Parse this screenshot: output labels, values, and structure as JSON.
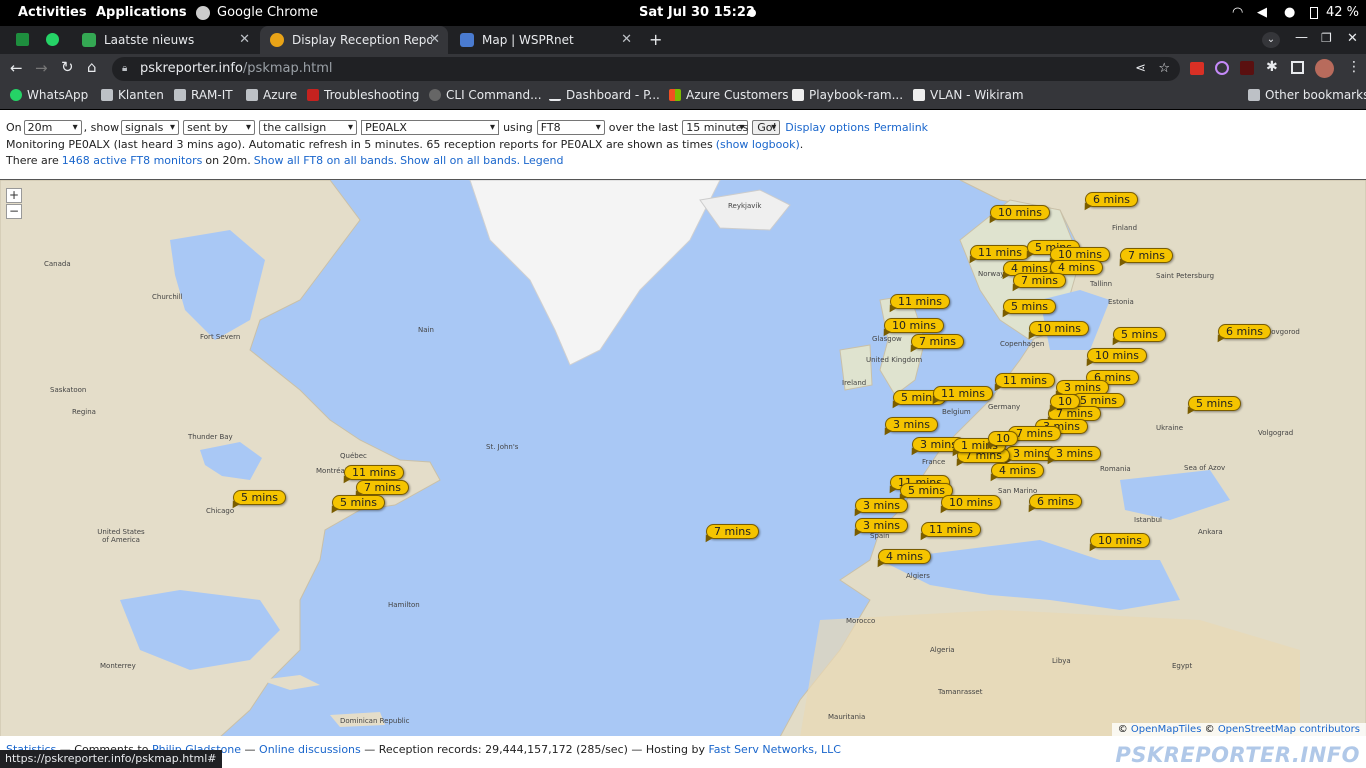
{
  "system_bar": {
    "activities": "Activities",
    "applications": "Applications",
    "app_name": "Google Chrome",
    "clock": "Sat Jul 30  15:22",
    "battery": "42 %"
  },
  "tabs": [
    {
      "label": "Laatste nieuws"
    },
    {
      "label": "Display Reception Reports"
    },
    {
      "label": "Map | WSPRnet"
    }
  ],
  "address": {
    "host": "pskreporter.info",
    "path": "/pskmap.html"
  },
  "bookmarks": [
    "WhatsApp",
    "Klanten",
    "RAM-IT",
    "Azure",
    "Troubleshooting",
    "CLI Command...",
    "Dashboard - P...",
    "Azure Customers",
    "Playbook-ram...",
    "VLAN - Wikiram",
    "Other bookmarks"
  ],
  "controls": {
    "on_label": "On",
    "band": "20m",
    "show_label": ", show",
    "show_value": "signals",
    "sent_value": "sent by",
    "target_value": "the callsign",
    "callsign": "PE0ALX",
    "using_label": "using",
    "mode": "FT8",
    "over_label": "over the last",
    "period": "15 minutes",
    "go": "Go!",
    "display_options": "Display options",
    "permalink": "Permalink",
    "monitor_text": "Monitoring PE0ALX (last heard 3 mins ago). Automatic refresh in 5 minutes. 65 reception reports for PE0ALX are shown as times",
    "show_logbook": "(show logbook)",
    "there_are": "There are",
    "active_monitors": "1468 active FT8 monitors",
    "on_band": "on 20m.",
    "show_all_ft8": "Show all FT8 on all bands.",
    "show_all": "Show all on all bands.",
    "legend": "Legend"
  },
  "map": {
    "zoom_in": "+",
    "zoom_out": "−",
    "attribution_prefix": "©",
    "attribution_omt": "OpenMapTiles",
    "attribution_mid": "©",
    "attribution_osm": "OpenStreetMap contributors",
    "places": [
      {
        "t": "Reykjavík"
      },
      {
        "t": "Finland"
      },
      {
        "t": "Canada"
      },
      {
        "t": "Churchill"
      },
      {
        "t": "Fort Severn"
      },
      {
        "t": "Nain"
      },
      {
        "t": "Saskatoon"
      },
      {
        "t": "Regina"
      },
      {
        "t": "Thunder Bay"
      },
      {
        "t": "Québec"
      },
      {
        "t": "Montréal"
      },
      {
        "t": "St. John's"
      },
      {
        "t": "United States of America"
      },
      {
        "t": "Chicago"
      },
      {
        "t": "Hamilton"
      },
      {
        "t": "Monterrey"
      },
      {
        "t": "Dominican Republic"
      },
      {
        "t": "Glasgow"
      },
      {
        "t": "United Kingdom"
      },
      {
        "t": "Ireland"
      },
      {
        "t": "Belgium"
      },
      {
        "t": "Germany"
      },
      {
        "t": "France"
      },
      {
        "t": "San Marino"
      },
      {
        "t": "Spain"
      },
      {
        "t": "Algiers"
      },
      {
        "t": "Morocco"
      },
      {
        "t": "Algeria"
      },
      {
        "t": "Libya"
      },
      {
        "t": "Egypt"
      },
      {
        "t": "Tamanrasset"
      },
      {
        "t": "Mauritania"
      },
      {
        "t": "Estonia"
      },
      {
        "t": "Saint Petersburg"
      },
      {
        "t": "Novgorod"
      },
      {
        "t": "Ukraine"
      },
      {
        "t": "Volgograd"
      },
      {
        "t": "Sea of Azov"
      },
      {
        "t": "Romania"
      },
      {
        "t": "Istanbul"
      },
      {
        "t": "Ankara"
      },
      {
        "t": "Copenhagen"
      },
      {
        "t": "Norway"
      },
      {
        "t": "Tallinn"
      }
    ],
    "reports": [
      {
        "t": "6 mins"
      },
      {
        "t": "10 mins"
      },
      {
        "t": "11 mins"
      },
      {
        "t": "5 mins"
      },
      {
        "t": "10 mins"
      },
      {
        "t": "7 mins"
      },
      {
        "t": "4 mins"
      },
      {
        "t": "4 mins"
      },
      {
        "t": "7 mins"
      },
      {
        "t": "11 mins"
      },
      {
        "t": "5 mins"
      },
      {
        "t": "10 mins"
      },
      {
        "t": "10 mins"
      },
      {
        "t": "7 mins"
      },
      {
        "t": "5 mins"
      },
      {
        "t": "6 mins"
      },
      {
        "t": "10 mins"
      },
      {
        "t": "6 mins"
      },
      {
        "t": "11 mins"
      },
      {
        "t": "3 mins"
      },
      {
        "t": "5 mins"
      },
      {
        "t": "11 mins"
      },
      {
        "t": "5 mins"
      },
      {
        "t": "5 mins"
      },
      {
        "t": "3 mins"
      },
      {
        "t": "7 mins"
      },
      {
        "t": "3 mins"
      },
      {
        "t": "7 mins"
      },
      {
        "t": "3 mins"
      },
      {
        "t": "3 mins"
      },
      {
        "t": "3 mins"
      },
      {
        "t": "7 mins"
      },
      {
        "t": "1 mins"
      },
      {
        "t": "4 mins"
      },
      {
        "t": "11 mins"
      },
      {
        "t": "5 mins"
      },
      {
        "t": "3 mins"
      },
      {
        "t": "10 mins"
      },
      {
        "t": "6 mins"
      },
      {
        "t": "3 mins"
      },
      {
        "t": "11 mins"
      },
      {
        "t": "10 mins"
      },
      {
        "t": "4 mins"
      },
      {
        "t": "11 mins"
      },
      {
        "t": "7 mins"
      },
      {
        "t": "5 mins"
      },
      {
        "t": "5 mins"
      },
      {
        "t": "7 mins"
      },
      {
        "t": "10"
      },
      {
        "t": "10"
      }
    ]
  },
  "footer": {
    "statistics": "Statistics",
    "comments": "— Comments to",
    "author": "Philip Gladstone",
    "discussions": "Online discussions",
    "records": "— Reception records: 29,444,157,172 (285/sec) — Hosting by",
    "host": "Fast Serv Networks, LLC",
    "brand": "PSKREPORTER.INFO",
    "status_url": "https://pskreporter.info/pskmap.html#"
  },
  "colors": {
    "bubble": "#f5c400",
    "ocean": "#a9c8f5",
    "link": "#1a66cc"
  }
}
